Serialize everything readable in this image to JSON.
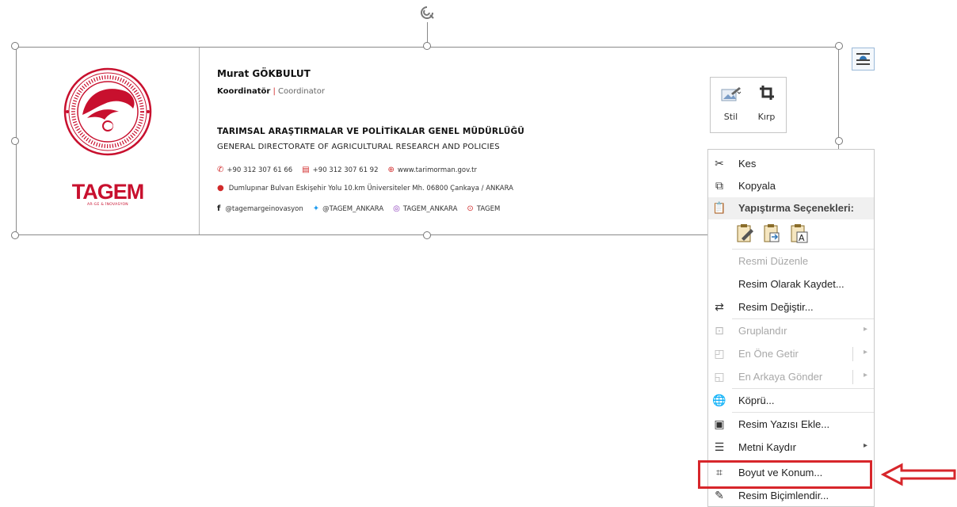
{
  "signature": {
    "name": "Murat GÖKBULUT",
    "title_tr": "Koordinatör",
    "title_sep": "|",
    "title_en": "Coordinator",
    "org_tr": "TARIMSAL ARAŞTIRMALAR VE POLİTİKALAR GENEL MÜDÜRLÜĞÜ",
    "org_en": "GENERAL DIRECTORATE OF AGRICULTURAL RESEARCH AND POLICIES",
    "phone": "+90 312 307 61 66",
    "fax": "+90 312 307 61 92",
    "website": "www.tarimorman.gov.tr",
    "address": "Dumlupınar Bulvarı  Eskişehir Yolu 10.km  Üniversiteler Mh.  06800  Çankaya / ANKARA",
    "facebook": "@tagemargeinovasyon",
    "twitter": "@TAGEM_ANKARA",
    "instagram": "TAGEM_ANKARA",
    "youtube": "TAGEM",
    "logo_word": "TAGEM",
    "logo_sub": "AR-GE & İNOVASYON"
  },
  "mini_toolbar": {
    "style_label": "Stil",
    "crop_label": "Kırp"
  },
  "context_menu": {
    "cut": "Kes",
    "copy": "Kopyala",
    "paste_options": "Yapıştırma Seçenekleri:",
    "edit_picture": "Resmi Düzenle",
    "save_as_picture": "Resim Olarak Kaydet...",
    "change_picture": "Resim Değiştir...",
    "group": "Gruplandır",
    "bring_to_front": "En Öne Getir",
    "send_to_back": "En Arkaya Gönder",
    "link": "Köprü...",
    "insert_caption": "Resim Yazısı Ekle...",
    "wrap_text": "Metni Kaydır",
    "size_position": "Boyut ve Konum...",
    "format_picture": "Resim Biçimlendir..."
  },
  "colors": {
    "highlight": "#d7262b",
    "brand_red": "#c8102e",
    "disabled_text": "#a8a8a8"
  }
}
